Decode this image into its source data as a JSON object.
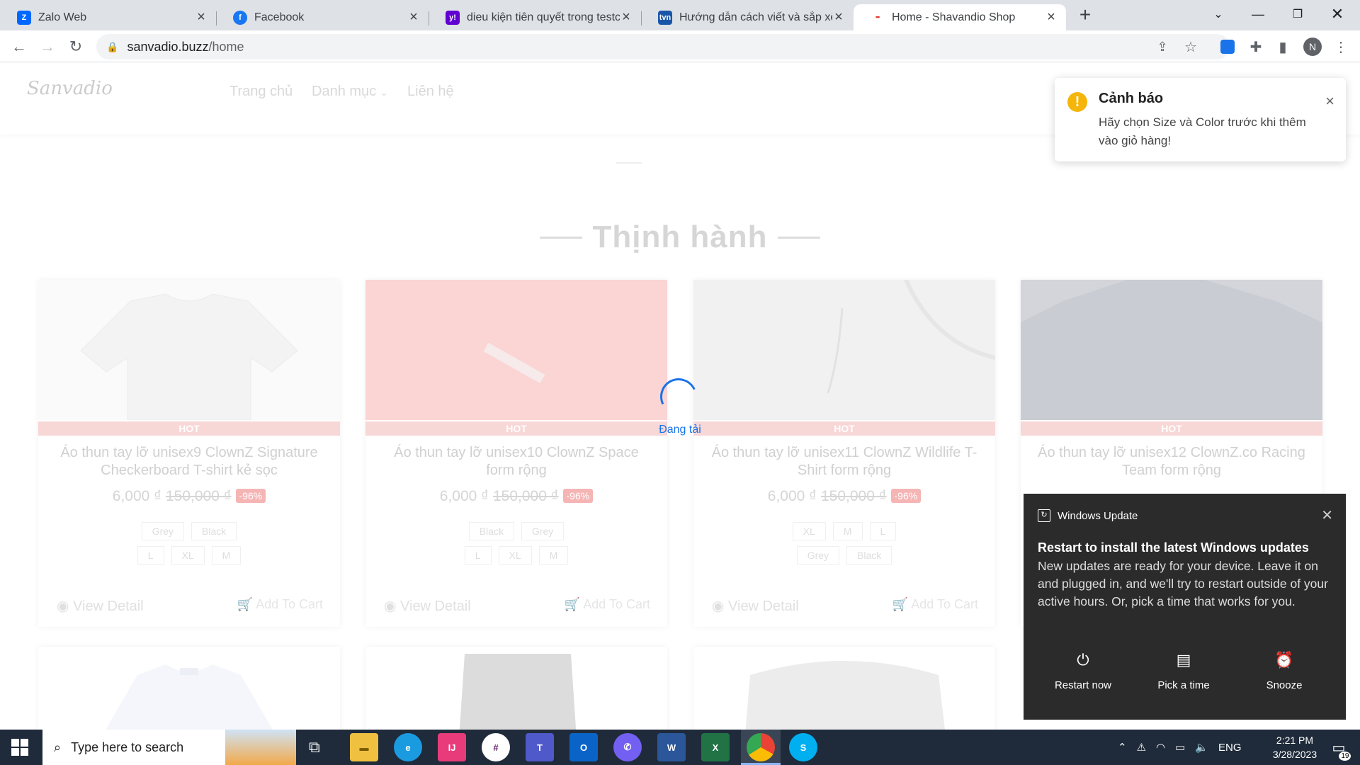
{
  "browser": {
    "tabs": [
      {
        "title": "Zalo Web",
        "icon": "zalo-icon",
        "color": "#0068ff"
      },
      {
        "title": "Facebook",
        "icon": "facebook-icon",
        "color": "#1877f2"
      },
      {
        "title": "dieu kiện tiên quyết trong testcas",
        "icon": "yahoo-icon",
        "color": "#6001d2"
      },
      {
        "title": "Hướng dẫn cách viết và sắp xếp",
        "icon": "tvn-icon",
        "color": "#1a56a8"
      },
      {
        "title": "Home - Shavandio Shop",
        "icon": "shop-icon",
        "color": "#e53935"
      }
    ],
    "url_host": "sanvadio.buzz",
    "url_path": "/home",
    "profile_initial": "N"
  },
  "site": {
    "logo": "Sanvadio",
    "nav": [
      "Trang chủ",
      "Danh mục",
      "Liên hệ"
    ],
    "section_title": "Thịnh hành",
    "loading_text": "Đang tải",
    "products": [
      {
        "name": "Áo thun tay lỡ unisex9 ClownZ Signature Checkerboard T-shirt kẻ sọc",
        "price": "6,000 ₫",
        "old_price": "150,000 ₫",
        "discount": "-96%",
        "row1": [
          "Grey",
          "Black"
        ],
        "row2": [
          "L",
          "XL",
          "M"
        ],
        "badge": "HOT"
      },
      {
        "name": "Áo thun tay lỡ unisex10 ClownZ Space form rộng",
        "price": "6,000 ₫",
        "old_price": "150,000 ₫",
        "discount": "-96%",
        "row1": [
          "Black",
          "Grey"
        ],
        "row2": [
          "L",
          "XL",
          "M"
        ],
        "badge": "HOT"
      },
      {
        "name": "Áo thun tay lỡ unisex11 ClownZ Wildlife T-Shirt form rộng",
        "price": "6,000 ₫",
        "old_price": "150,000 ₫",
        "discount": "-96%",
        "row1": [
          "XL",
          "M",
          "L"
        ],
        "row2": [
          "Grey",
          "Black"
        ],
        "badge": "HOT"
      },
      {
        "name": "Áo thun tay lỡ unisex12 ClownZ.co Racing Team form rộng",
        "badge": "HOT"
      }
    ],
    "view_detail": "View Detail",
    "add_to_cart": "Add To Cart"
  },
  "toast": {
    "title": "Cảnh báo",
    "message": "Hãy chọn Size và Color trước khi thêm vào giỏ hàng!"
  },
  "windows_update": {
    "app": "Windows Update",
    "heading": "Restart to install the latest Windows updates",
    "body": "New updates are ready for your device. Leave it on and plugged in, and we'll try to restart outside of your active hours. Or, pick a time that works for you.",
    "actions": [
      "Restart now",
      "Pick a time",
      "Snooze"
    ]
  },
  "taskbar": {
    "search_placeholder": "Type here to search",
    "lang": "ENG",
    "time": "2:21 PM",
    "date": "3/28/2023",
    "notif_count": "19"
  }
}
